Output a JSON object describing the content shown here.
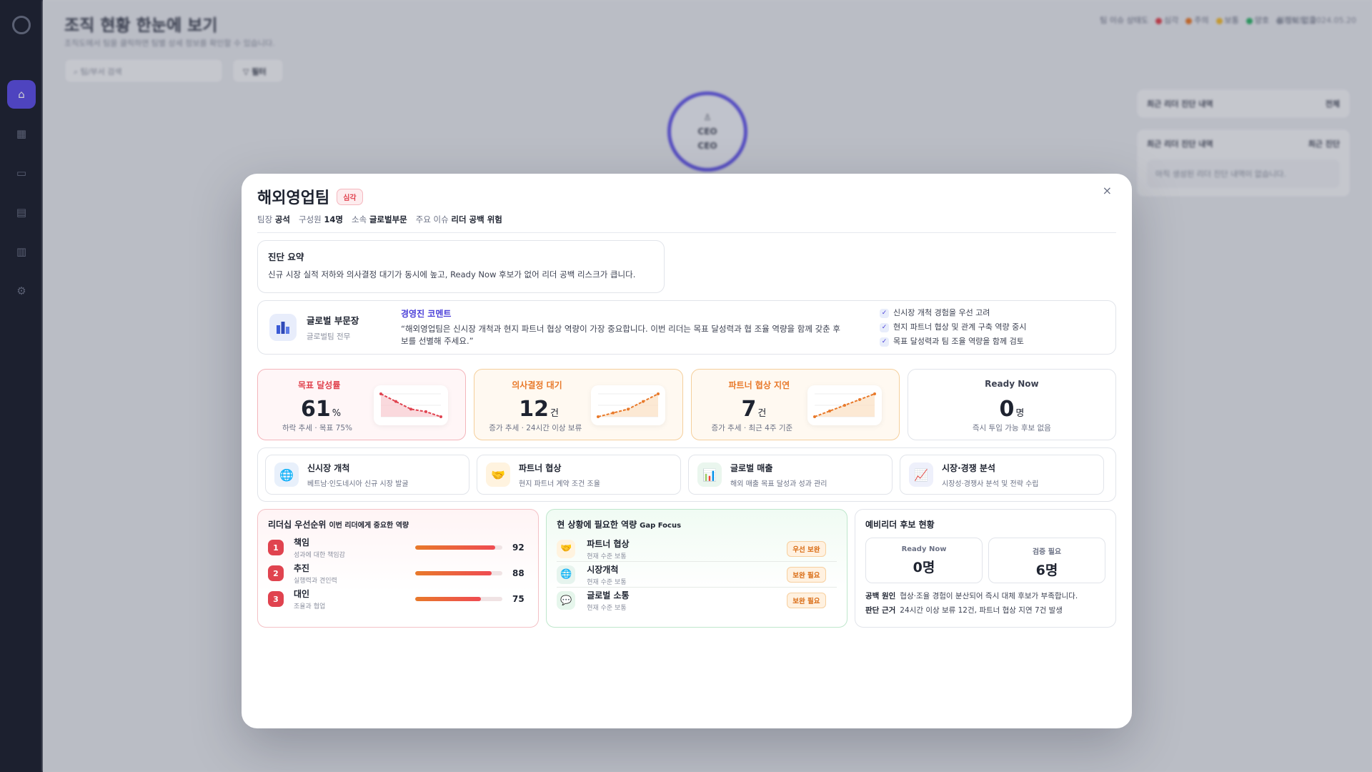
{
  "background": {
    "title": "조직 현황 한눈에 보기",
    "subtitle": "조직도에서 팀을 클릭하면 팀별 상세 정보를 확인할 수 있습니다.",
    "search_placeholder": "팀/부서 검색",
    "filter_label": "필터",
    "legend_title": "팀 이슈 상태도",
    "legend": [
      {
        "label": "심각",
        "color": "#e0434f"
      },
      {
        "label": "주의",
        "color": "#e8792a"
      },
      {
        "label": "보통",
        "color": "#f1b92f"
      },
      {
        "label": "양호",
        "color": "#2fb36a"
      },
      {
        "label": "정보 없음",
        "color": "#9aa0ad"
      }
    ],
    "updated": "업데이트: 2024.05.20",
    "ceo": {
      "title": "CEO",
      "name": "CEO"
    },
    "panel1": {
      "title": "최근 리더 진단 내역",
      "action": "전체"
    },
    "panel2": {
      "title": "최근 리더 진단 내역",
      "action": "최근 진단",
      "empty": "아직 생성된 리더 진단 내역이 없습니다."
    }
  },
  "sidebar": {
    "icons": [
      "home-icon",
      "grid-icon",
      "chat-icon",
      "doc-icon",
      "report-icon",
      "settings-icon"
    ]
  },
  "modal": {
    "title": "해외영업팀",
    "badge": "심각",
    "meta": [
      {
        "k": "팀장",
        "v": "공석"
      },
      {
        "k": "구성원",
        "v": "14명"
      },
      {
        "k": "소속",
        "v": "글로벌부문"
      },
      {
        "k": "주요 이슈",
        "v": "리더 공백 위험"
      }
    ],
    "close": "×",
    "summary": {
      "label": "진단 요약",
      "text": "신규 시장 실적 저하와 의사결정 대기가 동시에 높고, Ready Now 후보가 없어 리더 공백 리스크가 큽니다."
    },
    "comment": {
      "dept": "글로벌 부문장",
      "dept_sub": "글로벌팀 전무",
      "heading": "경영진 코멘트",
      "text": "“해외영업팀은 신시장 개척과 현지 파트너 협상 역량이 가장 중요합니다. 이번 리더는 목표 달성력과 협 조율 역량을 함께 갖춘 후보를 선별해 주세요.”",
      "checks": [
        "신시장 개척 경험을 우선 고려",
        "현지 파트너 협상 및 관계 구축 역량 중시",
        "목표 달성력과 팀 조율 역량을 함께 검토"
      ]
    },
    "kpis": [
      {
        "label": "목표 달성률",
        "value": "61",
        "unit": "%",
        "sub": "하락 추세 · 목표 75%",
        "tone": "red",
        "trend": [
          70,
          67,
          64,
          63,
          61
        ]
      },
      {
        "label": "의사결정 대기",
        "value": "12",
        "unit": "건",
        "sub": "증가 추세 · 24시간 이상 보류",
        "tone": "orange",
        "trend": [
          6,
          7,
          8,
          10,
          12
        ]
      },
      {
        "label": "파트너 협상 지연",
        "value": "7",
        "unit": "건",
        "sub": "증가 추세 · 최근 4주 기준",
        "tone": "orange",
        "trend": [
          3,
          4,
          5,
          6,
          7
        ]
      },
      {
        "label": "Ready Now",
        "value": "0",
        "unit": "명",
        "sub": "즉시 투입 가능 후보 없음",
        "tone": "white"
      }
    ],
    "themes": [
      {
        "name": "신시장 개척",
        "sub": "베트남·인도네시아 신규 시장 발굴",
        "icon": "globe-icon",
        "glyph": "🌐",
        "bg": "#e8f0fb"
      },
      {
        "name": "파트너 협상",
        "sub": "현지 파트너 계약 조건 조율",
        "icon": "handshake-icon",
        "glyph": "🤝",
        "bg": "#fff3df"
      },
      {
        "name": "글로벌 매출",
        "sub": "해외 매출 목표 달성과 성과 관리",
        "icon": "bar-chart-icon",
        "glyph": "📊",
        "bg": "#eaf6ee"
      },
      {
        "name": "시장·경쟁 분석",
        "sub": "시장성·경쟁사 분석 및 전략 수립",
        "icon": "trend-icon",
        "glyph": "📈",
        "bg": "#eef0fb"
      }
    ],
    "leadership": {
      "title": "리더십 우선순위",
      "subtitle": "이번 리더에게 중요한 역량",
      "items": [
        {
          "rank": "1",
          "name": "책임",
          "sub": "성과에 대한 책임감",
          "score": 92
        },
        {
          "rank": "2",
          "name": "추진",
          "sub": "실행력과 견인력",
          "score": 88
        },
        {
          "rank": "3",
          "name": "대인",
          "sub": "조율과 협업",
          "score": 75
        }
      ],
      "rank_colors": [
        "#e0434f",
        "#e0434f",
        "#e0434f"
      ]
    },
    "gap": {
      "title": "현 상황에 필요한 역량",
      "subtitle": "Gap Focus",
      "items": [
        {
          "name": "파트너 협상",
          "sub": "현재 수준 보통",
          "tag": "우선 보완",
          "icon": "handshake-icon",
          "glyph": "🤝",
          "bg": "#fff3df"
        },
        {
          "name": "시장개척",
          "sub": "현재 수준 보통",
          "tag": "보완 필요",
          "icon": "globe-icon",
          "glyph": "🌐",
          "bg": "#e6f4ee"
        },
        {
          "name": "글로벌 소통",
          "sub": "현재 수준 보통",
          "tag": "보완 필요",
          "icon": "chat-bubble-icon",
          "glyph": "💬",
          "bg": "#e6f6ec"
        }
      ]
    },
    "candidates": {
      "title": "예비리더 후보 현황",
      "cards": [
        {
          "label": "Ready Now",
          "value": "0명"
        },
        {
          "label": "검증 필요",
          "value": "6명"
        }
      ],
      "notes": [
        {
          "k": "공백 원인",
          "v": "협상·조율 경험이 분산되어 즉시 대체 후보가 부족합니다."
        },
        {
          "k": "판단 근거",
          "v": "24시간 이상 보류 12건, 파트너 협상 지연 7건 발생"
        }
      ]
    }
  }
}
